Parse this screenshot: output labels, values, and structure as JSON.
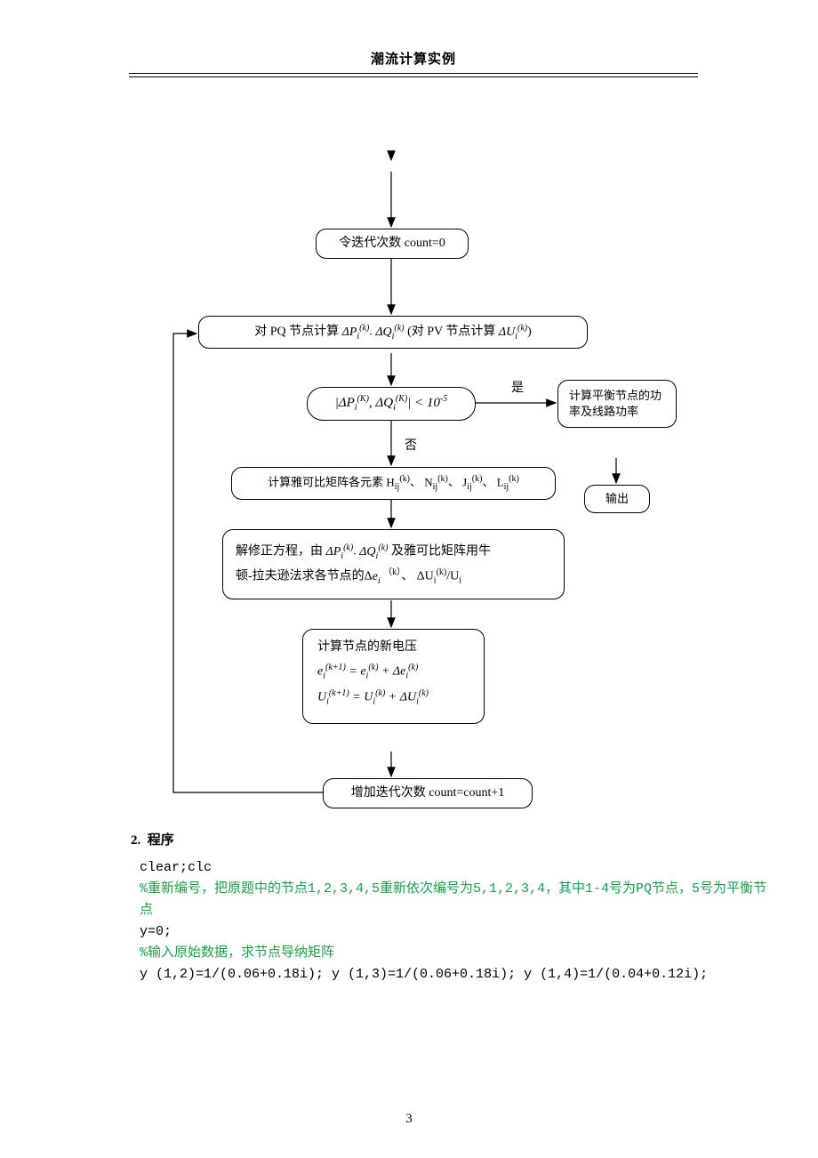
{
  "header": {
    "title": "潮流计算实例"
  },
  "flow": {
    "init": "令迭代次数 count=0",
    "compute_pq_a": "对 PQ 节点计算 ",
    "compute_pq_b": "(对 PV 节点计算 ",
    "decision": "|ΔPᵢ⁽ᴷ⁾, ΔQᵢ⁽ᴷ⁾| < 10⁻⁵",
    "yes_label": "是",
    "no_label": "否",
    "balance": "计算平衡节点的功率及线路功率",
    "output": "输出",
    "jacobian_a": "计算雅可比矩阵各元素 H",
    "correction_a": "解修正方程，由 ",
    "correction_b": " 及雅可比矩阵用牛",
    "correction_c": "顿-拉夫逊法求各节点的Δ",
    "newvolt_a": "计算节点的新电压",
    "inc": "增加迭代次数 count=count+1"
  },
  "math": {
    "dP": "ΔP",
    "dQ": "ΔQ",
    "dU": "ΔU",
    "de": "Δe",
    "i": "i",
    "k": "k",
    "kp1": "k+1",
    "U": "U",
    "e": "e",
    "H": "H",
    "N": "N",
    "J": "J",
    "L": "L",
    "ij": "ij",
    "sep": "、"
  },
  "section": {
    "num": "2.",
    "title": "程序"
  },
  "code": {
    "l1": "clear;clc",
    "c1": "%重新编号，把原题中的节点1,2,3,4,5重新依次编号为5,1,2,3,4，其中1-4号为PQ节点，5号为平衡节点",
    "l2": "y=0;",
    "c2": "%输入原始数据，求节点导纳矩阵",
    "l3": "y (1,2)=1/(0.06+0.18i); y (1,3)=1/(0.06+0.18i); y (1,4)=1/(0.04+0.12i);"
  },
  "page_number": "3"
}
